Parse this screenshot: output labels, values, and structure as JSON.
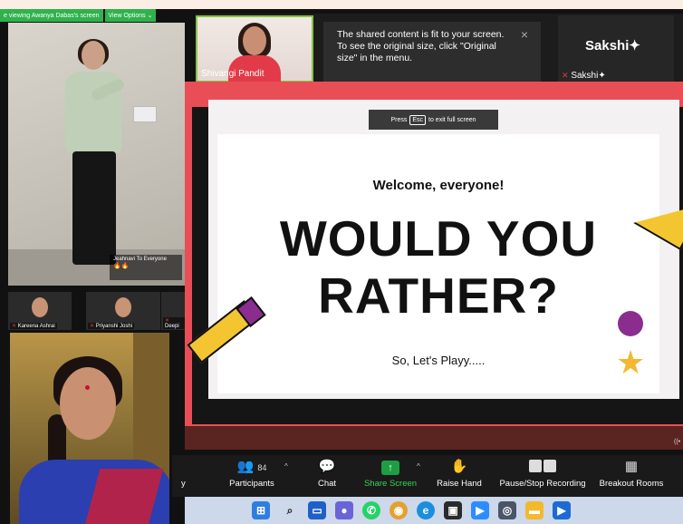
{
  "banner": {
    "viewing_text": "e viewing Awanya Dabas's screen",
    "view_options": "View Options"
  },
  "left_video": {
    "caption_name": "Jeahnavi To Everyone",
    "caption_emoji": "🔥🔥"
  },
  "thumbnails": [
    {
      "name": "Kareena Ashrai"
    },
    {
      "name": "Priyanshi Joshi"
    },
    {
      "name": "Deepi"
    }
  ],
  "gallery": {
    "tile1_name": "Shivangi Pandit",
    "tile_sakshi_big": "Sakshi✦",
    "tile_sakshi_small": "Sakshi✦"
  },
  "tooltip": {
    "text": "The shared content is fit to your screen. To see the original size, click \"Original size\" in the menu.",
    "close": "×"
  },
  "slide": {
    "esc_prefix": "Press",
    "esc_key": "Esc",
    "esc_suffix": "to exit full screen",
    "welcome": "Welcome, everyone!",
    "line1": "WOULD YOU",
    "line2": "RATHER?",
    "sub": "So, Let's Playy....."
  },
  "toolbar": {
    "partial_left": "y",
    "participants_label": "Participants",
    "participants_count": "84",
    "chat_label": "Chat",
    "share_label": "Share Screen",
    "raise_label": "Raise Hand",
    "record_label": "Pause/Stop Recording",
    "breakout_label": "Breakout Rooms"
  },
  "colors": {
    "slide_red": "#e94e56",
    "accent_purple": "#8a2d8f",
    "accent_yellow": "#f3c531",
    "share_green": "#39d353"
  },
  "taskbar_icons": [
    "windows-start-icon",
    "search-icon",
    "file-explorer-icon",
    "teams-chat-icon",
    "whatsapp-icon",
    "chrome-icon",
    "edge-icon",
    "store-icon",
    "zoom-icon",
    "camera-icon",
    "folder-icon",
    "media-player-icon"
  ]
}
